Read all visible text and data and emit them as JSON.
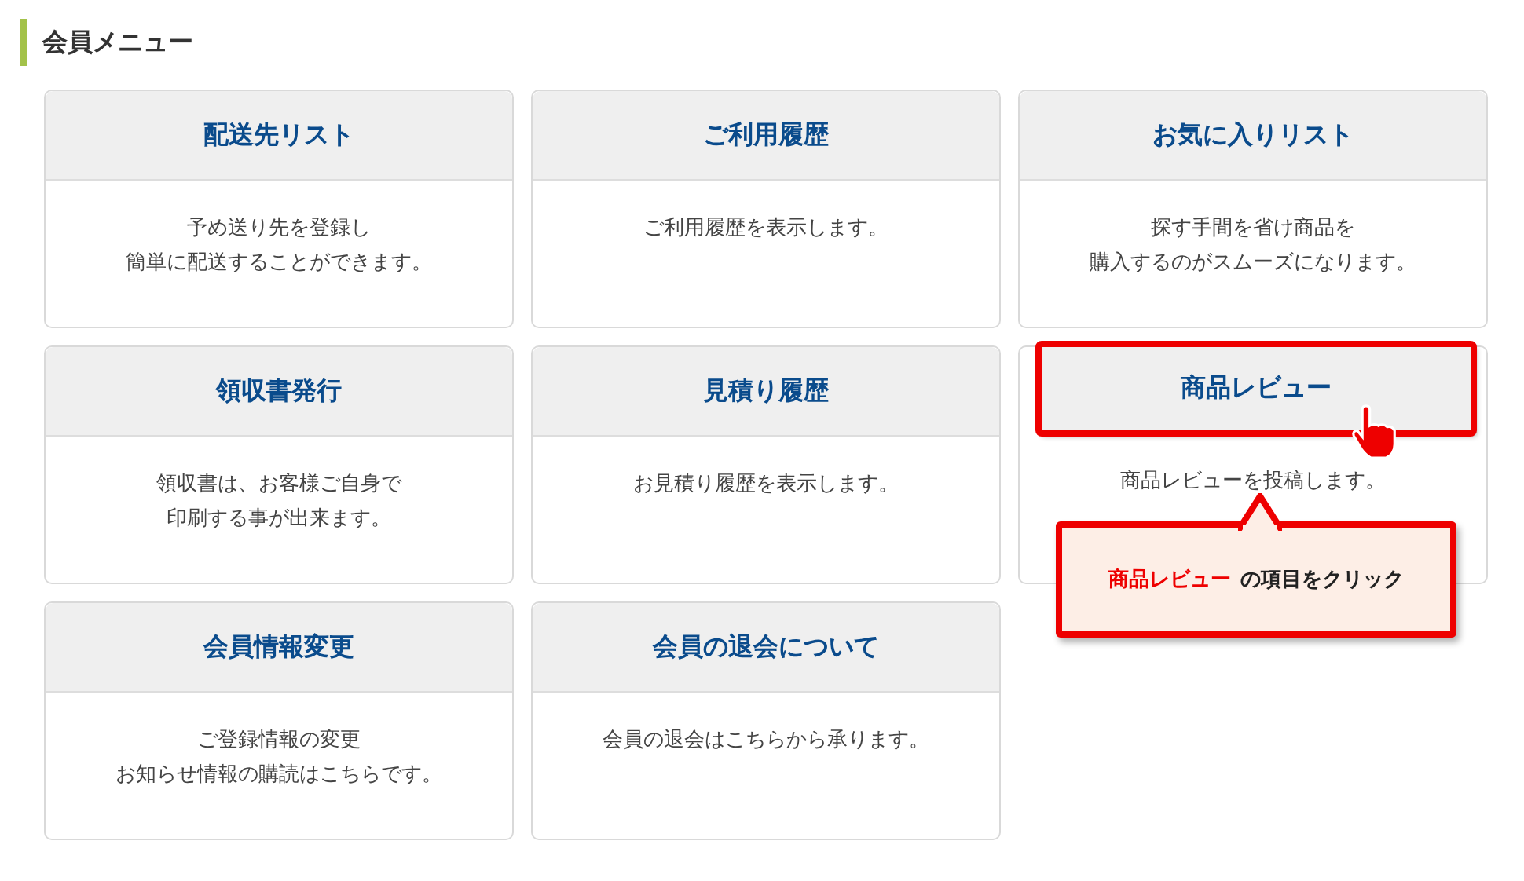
{
  "heading": "会員メニュー",
  "cards": [
    {
      "title": "配送先リスト",
      "lines": [
        "予め送り先を登録し",
        "簡単に配送することができます。"
      ],
      "highlighted": false
    },
    {
      "title": "ご利用履歴",
      "lines": [
        "ご利用履歴を表示します。"
      ],
      "highlighted": false
    },
    {
      "title": "お気に入りリスト",
      "lines": [
        "探す手間を省け商品を",
        "購入するのがスムーズになります。"
      ],
      "highlighted": false
    },
    {
      "title": "領収書発行",
      "lines": [
        "領収書は、お客様ご自身で",
        "印刷する事が出来ます。"
      ],
      "highlighted": false
    },
    {
      "title": "見積り履歴",
      "lines": [
        "お見積り履歴を表示します。"
      ],
      "highlighted": false
    },
    {
      "title": "商品レビュー",
      "lines": [
        "商品レビューを投稿します。"
      ],
      "highlighted": true
    },
    {
      "title": "会員情報変更",
      "lines": [
        "ご登録情報の変更",
        "お知らせ情報の購読はこちらです。"
      ],
      "highlighted": false
    },
    {
      "title": "会員の退会について",
      "lines": [
        "会員の退会はこちらから承ります。"
      ],
      "highlighted": false
    }
  ],
  "callout": {
    "highlight": "商品レビュー",
    "text": "の項目をクリック"
  }
}
